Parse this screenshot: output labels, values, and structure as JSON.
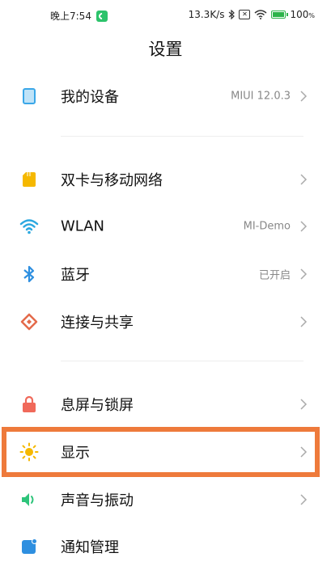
{
  "status_bar": {
    "time": "晚上7:54",
    "speed": "13.3K/s",
    "battery": "100"
  },
  "header": {
    "title": "设置"
  },
  "groups": [
    {
      "items": [
        {
          "label": "我的设备",
          "value": "MIUI 12.0.3",
          "icon": "device-icon"
        }
      ]
    },
    {
      "items": [
        {
          "label": "双卡与移动网络",
          "value": "",
          "icon": "sim-card-icon"
        },
        {
          "label": "WLAN",
          "value": "MI-Demo",
          "icon": "wifi-icon"
        },
        {
          "label": "蓝牙",
          "value": "已开启",
          "icon": "bluetooth-icon"
        },
        {
          "label": "连接与共享",
          "value": "",
          "icon": "connection-share-icon"
        }
      ]
    },
    {
      "items": [
        {
          "label": "息屏与锁屏",
          "value": "",
          "icon": "lock-icon"
        },
        {
          "label": "显示",
          "value": "",
          "icon": "sun-icon",
          "highlighted": true
        },
        {
          "label": "声音与振动",
          "value": "",
          "icon": "speaker-icon"
        },
        {
          "label": "通知管理",
          "value": "",
          "icon": "notification-icon"
        }
      ]
    }
  ],
  "colors": {
    "highlight": "#ee7a3b",
    "device": "#3aa7e8",
    "sim": "#f5b800",
    "wifi": "#2ba8e0",
    "bluetooth": "#2e8fe0",
    "share": "#e46a4a",
    "lock": "#f0695a",
    "sun": "#f5b800",
    "sound": "#2ec47a",
    "notify": "#2e8fe0"
  }
}
